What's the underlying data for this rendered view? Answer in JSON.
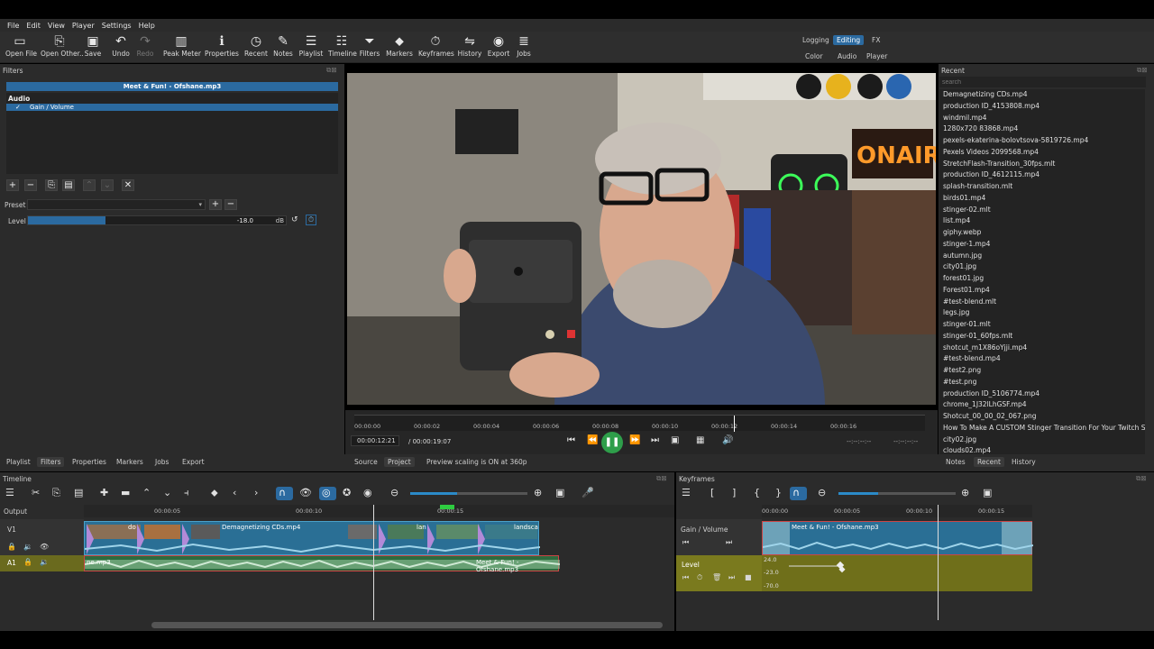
{
  "menu": [
    "File",
    "Edit",
    "View",
    "Player",
    "Settings",
    "Help"
  ],
  "toolbar": [
    {
      "label": "Open File",
      "icon": "folder-icon",
      "glyph": "▭"
    },
    {
      "label": "Open Other..",
      "icon": "open-other-icon",
      "glyph": "⎘"
    },
    {
      "label": "Save",
      "icon": "save-icon",
      "glyph": "▣"
    },
    {
      "label": "Undo",
      "icon": "undo-icon",
      "glyph": "↶"
    },
    {
      "label": "Redo",
      "icon": "redo-icon",
      "glyph": "↷"
    },
    {
      "label": "Peak Meter",
      "icon": "peak-meter-icon",
      "glyph": "▥"
    },
    {
      "label": "Properties",
      "icon": "info-icon",
      "glyph": "ℹ"
    },
    {
      "label": "Recent",
      "icon": "clock-icon",
      "glyph": "◷"
    },
    {
      "label": "Notes",
      "icon": "notes-icon",
      "glyph": "✎"
    },
    {
      "label": "Playlist",
      "icon": "playlist-icon",
      "glyph": "☰"
    },
    {
      "label": "Timeline",
      "icon": "timeline-icon",
      "glyph": "☷"
    },
    {
      "label": "Filters",
      "icon": "filter-icon",
      "glyph": "⏷"
    },
    {
      "label": "Markers",
      "icon": "marker-icon",
      "glyph": "⬥"
    },
    {
      "label": "Keyframes",
      "icon": "stopwatch-icon",
      "glyph": "⏱"
    },
    {
      "label": "History",
      "icon": "history-icon",
      "glyph": "⇋"
    },
    {
      "label": "Export",
      "icon": "export-icon",
      "glyph": "◉"
    },
    {
      "label": "Jobs",
      "icon": "jobs-icon",
      "glyph": "≣"
    }
  ],
  "modes": {
    "top": [
      "Logging",
      "Editing",
      "FX"
    ],
    "bottom": [
      "Color",
      "Audio",
      "Player"
    ],
    "active": "Editing"
  },
  "filters": {
    "title": "Filters",
    "clip": "Meet & Fun! - Ofshane.mp3",
    "section": "Audio",
    "item": "Gain / Volume",
    "check": "✓",
    "preset_label": "Preset",
    "level_label": "Level",
    "level_value": "-18.0",
    "level_unit": "dB",
    "level_fraction": 0.3
  },
  "player": {
    "ruler": [
      "00:00:00",
      "00:00:02",
      "00:00:04",
      "00:00:06",
      "00:00:08",
      "00:00:10",
      "00:00:12",
      "00:00:14",
      "00:00:16"
    ],
    "position": "00:00:12:21",
    "duration": "/ 00:00:19:07",
    "in_point": "--:--:--:--",
    "out_point": "--:--:--:--",
    "tabs": [
      "Source",
      "Project"
    ],
    "scaling": "Preview scaling is ON at 360p"
  },
  "recent": {
    "title": "Recent",
    "search_placeholder": "search",
    "files": [
      "Demagnetizing CDs.mp4",
      "production ID_4153808.mp4",
      "windmil.mp4",
      "1280x720 83868.mp4",
      "pexels-ekaterina-bolovtsova-5819726.mp4",
      "Pexels Videos 2099568.mp4",
      "StretchFlash-Transition_30fps.mlt",
      "production ID_4612115.mp4",
      "splash-transition.mlt",
      "birds01.mp4",
      "stinger-02.mlt",
      "list.mp4",
      "giphy.webp",
      "stinger-1.mp4",
      "autumn.jpg",
      "city01.jpg",
      "forest01.jpg",
      "Forest01.mp4",
      "#test-blend.mlt",
      "legs.jpg",
      "stinger-01.mlt",
      "stinger-01_60fps.mlt",
      "shotcut_m1X86oYjji.mp4",
      "#test-blend.mp4",
      "#test2.png",
      "#test.png",
      "production ID_5106774.mp4",
      "chrome_1J32lLhGSF.mp4",
      "Shotcut_00_00_02_067.png",
      "How To Make A CUSTOM Stinger Transition For Your Twitch S...",
      "city02.jpg",
      "clouds02.mp4"
    ],
    "tabs": [
      "Notes",
      "Recent",
      "History"
    ]
  },
  "left_tabs": [
    "Playlist",
    "Filters",
    "Properties",
    "Markers",
    "Jobs",
    "Export"
  ],
  "timeline": {
    "title": "Timeline",
    "ruler": [
      "00:00:05",
      "00:00:10",
      "00:00:15"
    ],
    "output": "Output",
    "v1": "V1",
    "a1": "A1",
    "v1_clip": "Demagnetizing CDs.mp4",
    "v1_labels": [
      "do",
      "lan",
      "landsca"
    ],
    "a1_left": "ne.mp3",
    "a1_right": "Meet & Fun! - Ofshane.mp3"
  },
  "keyframes": {
    "title": "Keyframes",
    "ruler": [
      "00:00:00",
      "00:00:05",
      "00:00:10",
      "00:00:15"
    ],
    "track": "Gain / Volume",
    "clip": "Meet & Fun! - Ofshane.mp3",
    "param": "Level",
    "scale": [
      "24.0",
      "-23.0",
      "-70.0"
    ]
  }
}
